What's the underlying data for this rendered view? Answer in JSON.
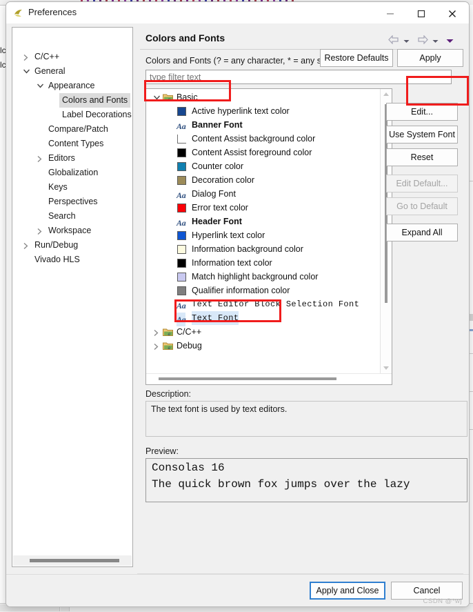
{
  "window": {
    "title": "Preferences",
    "icon": "eclipse-app-icon",
    "minimize_label": "minimize-icon",
    "maximize_label": "maximize-icon",
    "close_label": "close-icon"
  },
  "sidebar": {
    "filter_placeholder": "type filter text",
    "filter_value": "",
    "items": [
      {
        "label": "C/C++",
        "indent": 0,
        "twisty": "collapsed",
        "selected": false
      },
      {
        "label": "General",
        "indent": 0,
        "twisty": "expanded",
        "selected": false
      },
      {
        "label": "Appearance",
        "indent": 1,
        "twisty": "expanded",
        "selected": false
      },
      {
        "label": "Colors and Fonts",
        "indent": 2,
        "twisty": "none",
        "selected": true
      },
      {
        "label": "Label Decorations",
        "indent": 2,
        "twisty": "none",
        "selected": false
      },
      {
        "label": "Compare/Patch",
        "indent": 1,
        "twisty": "none",
        "selected": false
      },
      {
        "label": "Content Types",
        "indent": 1,
        "twisty": "none",
        "selected": false
      },
      {
        "label": "Editors",
        "indent": 1,
        "twisty": "collapsed",
        "selected": false
      },
      {
        "label": "Globalization",
        "indent": 1,
        "twisty": "none",
        "selected": false
      },
      {
        "label": "Keys",
        "indent": 1,
        "twisty": "none",
        "selected": false
      },
      {
        "label": "Perspectives",
        "indent": 1,
        "twisty": "none",
        "selected": false
      },
      {
        "label": "Search",
        "indent": 1,
        "twisty": "none",
        "selected": false
      },
      {
        "label": "Workspace",
        "indent": 1,
        "twisty": "collapsed",
        "selected": false
      },
      {
        "label": "Run/Debug",
        "indent": 0,
        "twisty": "collapsed",
        "selected": false
      },
      {
        "label": "Vivado HLS",
        "indent": 0,
        "twisty": "none",
        "selected": false
      }
    ]
  },
  "main": {
    "title": "Colors and Fonts",
    "filter_caption": "Colors and Fonts (? = any character, * = any string):",
    "filter_placeholder": "type filter text",
    "filter_value": "",
    "nav": {
      "back_icon": "back-arrow-icon",
      "back_menu_icon": "chevron-down-icon",
      "forward_icon": "forward-arrow-icon",
      "forward_menu_icon": "chevron-down-icon",
      "overflow_icon": "chevron-down-filled-icon"
    },
    "tree": [
      {
        "kind": "group",
        "label": "Basic",
        "twisty": "expanded",
        "icon": "folder-font-icon"
      },
      {
        "kind": "color",
        "label": "Active hyperlink text color",
        "color": "#17478f"
      },
      {
        "kind": "font",
        "label": "Banner Font",
        "style": "bold"
      },
      {
        "kind": "color",
        "label": "Content Assist background color",
        "color": "#ffffff",
        "open": true
      },
      {
        "kind": "color",
        "label": "Content Assist foreground color",
        "color": "#000000"
      },
      {
        "kind": "color",
        "label": "Counter color",
        "color": "#1080b0"
      },
      {
        "kind": "color",
        "label": "Decoration color",
        "color": "#9c8b59"
      },
      {
        "kind": "font",
        "label": "Dialog Font",
        "style": "normal"
      },
      {
        "kind": "color",
        "label": "Error text color",
        "color": "#fb0007"
      },
      {
        "kind": "font",
        "label": "Header Font",
        "style": "bold"
      },
      {
        "kind": "color",
        "label": "Hyperlink text color",
        "color": "#0f56d2"
      },
      {
        "kind": "color",
        "label": "Information background color",
        "color": "#fdfbe0"
      },
      {
        "kind": "color",
        "label": "Information text color",
        "color": "#000000"
      },
      {
        "kind": "color",
        "label": "Match highlight background color",
        "color": "#c9c9f0"
      },
      {
        "kind": "color",
        "label": "Qualifier information color",
        "color": "#7f7f7f"
      },
      {
        "kind": "font",
        "label": "Text Editor Block Selection Font",
        "style": "mono"
      },
      {
        "kind": "font",
        "label": "Text Font",
        "style": "mono",
        "selected": true
      },
      {
        "kind": "group",
        "label": "C/C++",
        "twisty": "collapsed",
        "icon": "folder-font-icon"
      },
      {
        "kind": "group",
        "label": "Debug",
        "twisty": "collapsed",
        "icon": "folder-font-icon"
      }
    ],
    "buttons": [
      {
        "label": "Edit...",
        "enabled": true
      },
      {
        "label": "Use System Font",
        "enabled": true
      },
      {
        "label": "Reset",
        "enabled": true
      },
      {
        "label": "Edit Default...",
        "enabled": false
      },
      {
        "label": "Go to Default",
        "enabled": false
      },
      {
        "label": "Expand All",
        "enabled": true
      }
    ],
    "description_label": "Description:",
    "description_text": "The text font is used by text editors.",
    "preview_label": "Preview:",
    "preview_lines": [
      "Consolas 16",
      "The quick brown fox jumps over the lazy"
    ]
  },
  "footer": {
    "restore_defaults": "Restore Defaults",
    "apply": "Apply",
    "apply_and_close": "Apply and Close",
    "cancel": "Cancel",
    "watermark": "CSDN @*wj"
  },
  "background": {
    "left_marks": [
      "lc",
      "lc"
    ],
    "right_text": [
      "a",
      "m",
      "r"
    ]
  },
  "colors": {
    "accent_blue": "#2f7fd0",
    "annotation_red": "#f01c1c",
    "selection_gray": "#dcdcdc",
    "selection_blue": "#d8e8f8"
  },
  "annotations": [
    {
      "name": "basic-node-highlight"
    },
    {
      "name": "edit-button-highlight"
    },
    {
      "name": "text-font-row-highlight"
    }
  ]
}
